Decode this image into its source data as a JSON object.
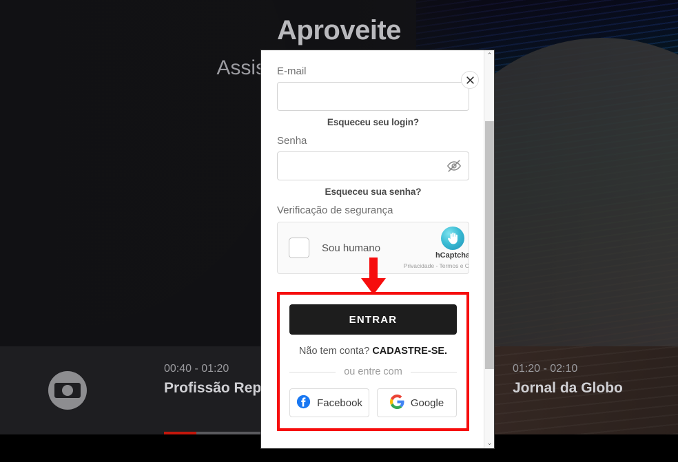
{
  "background": {
    "hero_title": "Aproveite",
    "hero_subtitle": "Assista de graça e gratuito",
    "epg": {
      "channel_logo": "globo-logo",
      "programs": [
        {
          "time": "00:40 - 01:20",
          "name": "Profissão Repórter"
        },
        {
          "time": "01:20 - 02:10",
          "name": "Jornal da Globo"
        }
      ]
    }
  },
  "modal": {
    "close_label": "✕",
    "email": {
      "label": "E-mail",
      "value": "",
      "placeholder": ""
    },
    "forgot_login": "Esqueceu seu login?",
    "password": {
      "label": "Senha",
      "value": "",
      "placeholder": "",
      "toggle_icon": "eye-off-icon"
    },
    "forgot_password": "Esqueceu sua senha?",
    "captcha": {
      "label": "Verificação de segurança",
      "checkbox_text": "Sou humano",
      "checked": false,
      "brand": "hCaptcha",
      "terms": "Privacidade - Termos e Condiçõ"
    },
    "actions": {
      "submit": "ENTRAR",
      "signup_prefix": "Não tem conta?",
      "signup_link": "CADASTRE-SE.",
      "divider": "ou entre com",
      "social": [
        {
          "name": "Facebook",
          "icon": "facebook-icon"
        },
        {
          "name": "Google",
          "icon": "google-icon"
        }
      ]
    },
    "scrollbar": {
      "up": "⌃",
      "down": "⌄"
    }
  },
  "annotation": {
    "highlight_color": "#f60d0d",
    "arrow": "down-arrow"
  }
}
